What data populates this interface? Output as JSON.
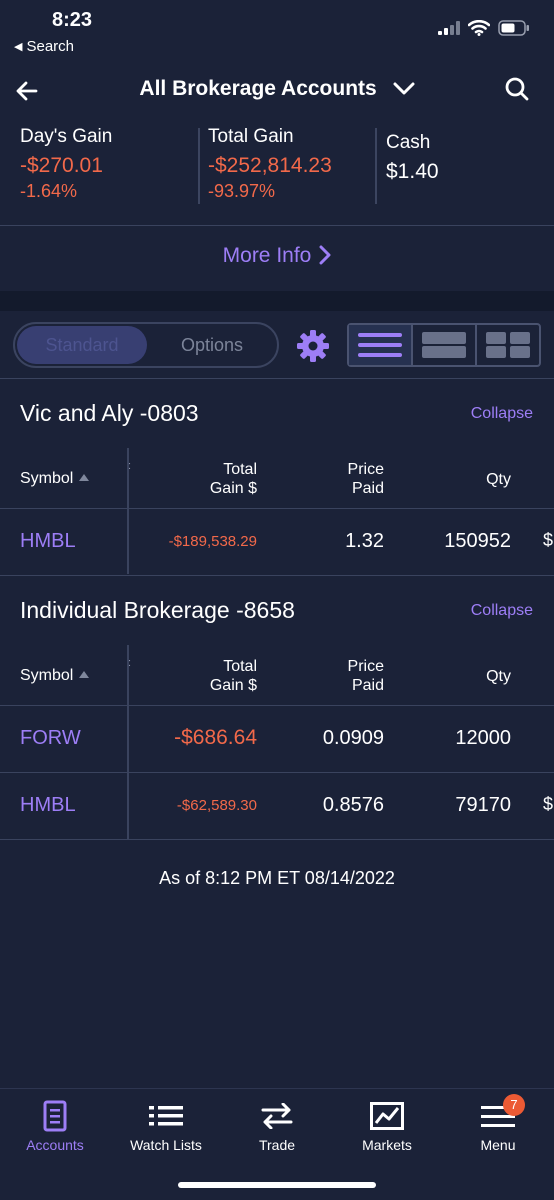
{
  "status": {
    "time": "8:23",
    "back_app": "Search"
  },
  "nav": {
    "title": "All Brokerage Accounts"
  },
  "summary": {
    "days_gain": {
      "label": "Day's Gain",
      "value": "-$270.01",
      "percent": "-1.64%"
    },
    "total_gain": {
      "label": "Total Gain",
      "value": "-$252,814.23",
      "percent": "-93.97%"
    },
    "cash": {
      "label": "Cash",
      "value": "$1.40"
    }
  },
  "more_info": "More Info",
  "toggle": {
    "standard": "Standard",
    "options": "Options"
  },
  "columns": {
    "symbol": "Symbol",
    "total_gain_1": "Total",
    "total_gain_2": "Gain $",
    "price_paid_1": "Price",
    "price_paid_2": "Paid",
    "qty": "Qty"
  },
  "accounts": [
    {
      "name": "Vic and Aly -0803",
      "collapse": "Collapse",
      "rows": [
        {
          "symbol": "HMBL",
          "total_gain": "-$189,538.29",
          "price_paid": "1.32",
          "qty": "150952"
        }
      ]
    },
    {
      "name": "Individual Brokerage -8658",
      "collapse": "Collapse",
      "rows": [
        {
          "symbol": "FORW",
          "total_gain": "-$686.64",
          "price_paid": "0.0909",
          "qty": "12000"
        },
        {
          "symbol": "HMBL",
          "total_gain": "-$62,589.30",
          "price_paid": "0.8576",
          "qty": "79170"
        }
      ]
    }
  ],
  "as_of": "As of 8:12 PM ET 08/14/2022",
  "tabs": [
    {
      "label": "Accounts",
      "icon": "document-icon",
      "active": true
    },
    {
      "label": "Watch Lists",
      "icon": "list-icon"
    },
    {
      "label": "Trade",
      "icon": "swap-arrows-icon"
    },
    {
      "label": "Markets",
      "icon": "chart-icon"
    },
    {
      "label": "Menu",
      "icon": "hamburger-icon",
      "badge": "7"
    }
  ],
  "colors": {
    "background": "#1b2238",
    "accent": "#9d7ef6",
    "negative": "#f2694a"
  }
}
